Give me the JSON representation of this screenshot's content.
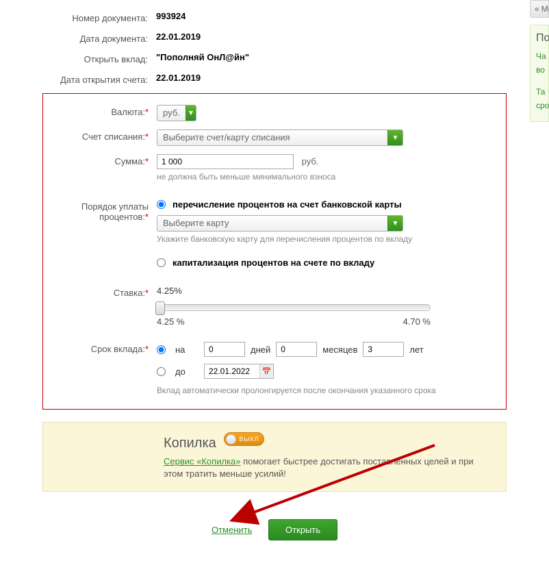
{
  "header": {
    "doc_number_label": "Номер документа:",
    "doc_number": "993924",
    "doc_date_label": "Дата документа:",
    "doc_date": "22.01.2019",
    "open_deposit_label": "Открыть вклад:",
    "open_deposit": "\"Пополняй ОнЛ@йн\"",
    "open_date_label": "Дата открытия счета:",
    "open_date": "22.01.2019"
  },
  "form": {
    "currency_label": "Валюта:",
    "currency_value": "руб.",
    "debit_account_label": "Счет списания:",
    "debit_account_placeholder": "Выберите счет/карту списания",
    "sum_label": "Сумма:",
    "sum_value": "1 000",
    "sum_unit": "руб.",
    "sum_hint": "не должна быть меньше минимального взноса",
    "interest_order_label": "Порядок уплаты процентов:",
    "interest_transfer_label": "перечисление процентов на счет банковской карты",
    "card_placeholder": "Выберите карту",
    "card_hint": "Укажите банковскую карту для перечисления процентов по вкладу",
    "interest_cap_label": "капитализация процентов на счете по вкладу",
    "rate_label": "Ставка:",
    "rate_value": "4.25%",
    "rate_min": "4.25 %",
    "rate_max": "4.70 %",
    "term_label": "Срок вклада:",
    "term_for": "на",
    "term_days": "0",
    "term_days_label": "дней",
    "term_months": "0",
    "term_months_label": "месяцев",
    "term_years": "3",
    "term_years_label": "лет",
    "term_until": "до",
    "term_until_date": "22.01.2022",
    "term_hint": "Вклад автоматически пролонгируется после окончания указанного срока"
  },
  "kopilka": {
    "title": "Копилка",
    "toggle_label": "ВЫКЛ",
    "link": "Сервис «Копилка»",
    "text": " помогает быстрее достигать поставленных целей и при этом тратить меньше усилий!"
  },
  "actions": {
    "cancel": "Отменить",
    "open": "Открыть"
  },
  "side": {
    "btn": "Мо",
    "title": "По",
    "line1": "Ча",
    "line2": "во",
    "line3": "Та",
    "line4": "сро"
  }
}
